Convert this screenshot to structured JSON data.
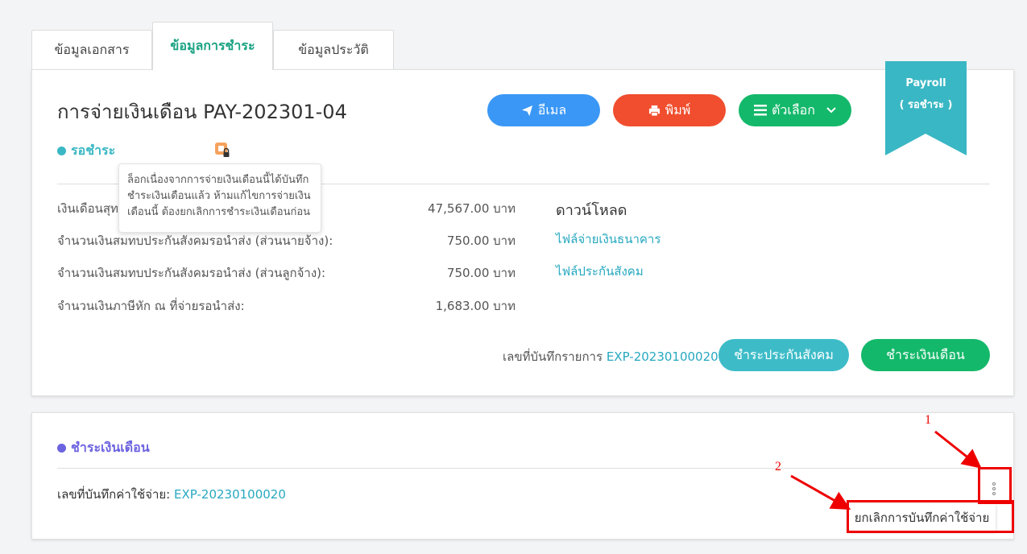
{
  "tabs": [
    "ข้อมูลเอกสาร",
    "ข้อมูลการชำระ",
    "ข้อมูลประวัติ"
  ],
  "header": {
    "title": "การจ่ายเงินเดือน PAY-202301-04",
    "status": "รอชำระ",
    "email_label": "อีเมล",
    "print_label": "พิมพ์",
    "options_label": "ตัวเลือก"
  },
  "ribbon": {
    "line1": "Payroll",
    "line2": "( รอชำระ )",
    "color": "#3ab7c4"
  },
  "tooltip": {
    "text": "ล็อกเนื่องจากการจ่ายเงินเดือนนี้ได้บันทึกชำระเงินเดือนแล้ว ห้ามแก้ไขการจ่ายเงินเดือนนี้ ต้องยกเลิกการชำระเงินเดือนก่อน"
  },
  "summary": {
    "rows": [
      {
        "label": "เงินเดือนสุทธิ",
        "value": "47,567.00 บาท"
      },
      {
        "label": "จำนวนเงินสมทบประกันสังคมรอนำส่ง (ส่วนนายจ้าง):",
        "value": "750.00 บาท"
      },
      {
        "label": "จำนวนเงินสมทบประกันสังคมรอนำส่ง (ส่วนลูกจ้าง):",
        "value": "750.00 บาท"
      },
      {
        "label": "จำนวนเงินภาษีหัก ณ ที่จ่ายรอนำส่ง:",
        "value": "1,683.00 บาท"
      }
    ]
  },
  "download": {
    "title": "ดาวน์โหลด",
    "links": [
      "ไฟล์จ่ายเงินธนาคาร",
      "ไฟล์ประกันสังคม"
    ]
  },
  "footer": {
    "exp_label": "เลขที่บันทึกรายการ",
    "exp_number": "EXP-20230100020",
    "sso_button": "ชำระประกันสังคม",
    "pay_button": "ชำระเงินเดือน"
  },
  "section2": {
    "title": "ชำระเงินเดือน",
    "row_label": "เลขที่บันทึกค่าใช้จ่าย:",
    "row_value": "EXP-20230100020",
    "menu_item": "ยกเลิกการบันทึกค่าใช้จ่าย"
  },
  "annotations": {
    "n1": "1",
    "n2": "2",
    "color": "#e00000"
  }
}
